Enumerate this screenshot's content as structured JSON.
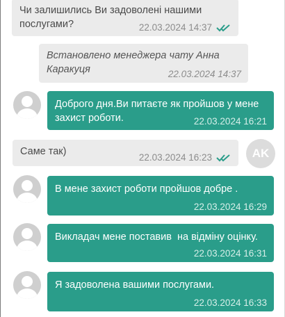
{
  "messages": [
    {
      "text": "Чи залишились Ви задоволені нашими послугами?",
      "time": "22.03.2024 14:37"
    },
    {
      "text": "Встановлено менеджера чату Анна Каракуця",
      "time": "22.03.2024 14:37"
    },
    {
      "text": "Доброго дня.Ви питаєте як пройшов у мене захист роботи.",
      "time": "22.03.2024 16:21"
    },
    {
      "text": "Саме так)",
      "time": "22.03.2024 16:23"
    },
    {
      "text": "В мене захист роботи пройшов добре .",
      "time": "22.03.2024 16:29"
    },
    {
      "text": "Викладач мене поставив  на відміну оцінку.",
      "time": "22.03.2024 16:31"
    },
    {
      "text": "Я задоволена вашими послугами.",
      "time": "22.03.2024 16:33"
    }
  ],
  "manager_avatar": {
    "initials": "AK"
  },
  "colors": {
    "incoming": "#2a9d8a",
    "outgoing": "#ebebeb",
    "check": "#2a9d8a"
  },
  "icons": {
    "read_receipt": "double-check-icon",
    "avatar": "user-avatar-icon"
  }
}
